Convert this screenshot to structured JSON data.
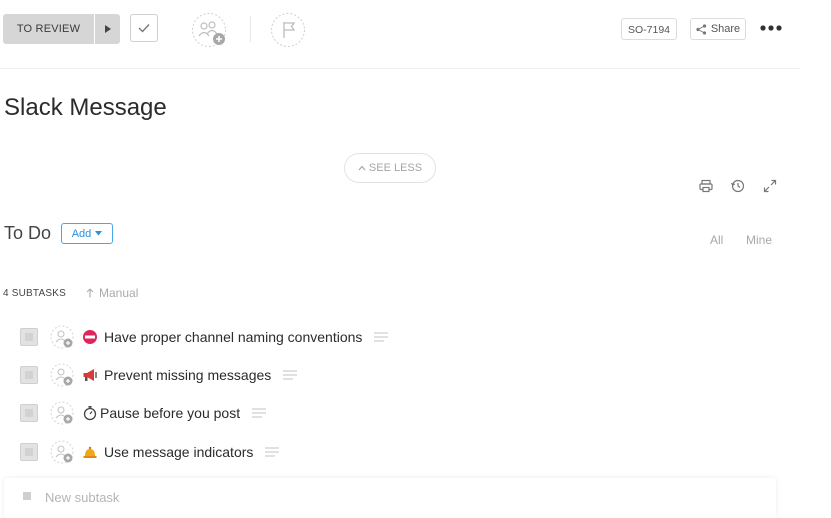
{
  "header": {
    "status_label": "TO REVIEW",
    "task_id": "SO-7194",
    "share_label": "Share"
  },
  "task": {
    "title": "Slack Message",
    "see_less_label": "SEE LESS"
  },
  "todo": {
    "title": "To Do",
    "add_label": "Add",
    "filter_all": "All",
    "filter_mine": "Mine"
  },
  "subtasks": {
    "count_label": "4 SUBTASKS",
    "sort_label": "Manual",
    "items": [
      {
        "label": "Have proper channel naming conventions",
        "icon": "no-entry-icon"
      },
      {
        "label": "Prevent missing messages",
        "icon": "megaphone-icon"
      },
      {
        "label": "Pause before you post",
        "icon": "stopwatch-icon"
      },
      {
        "label": "Use message indicators",
        "icon": "bell-icon"
      }
    ],
    "new_placeholder": "New subtask"
  },
  "colors": {
    "accent": "#2b8fdb",
    "status_bg": "#d6d6d6",
    "no_entry": "#e0245e",
    "megaphone": "#d83a3a",
    "bell": "#f2a71b"
  }
}
